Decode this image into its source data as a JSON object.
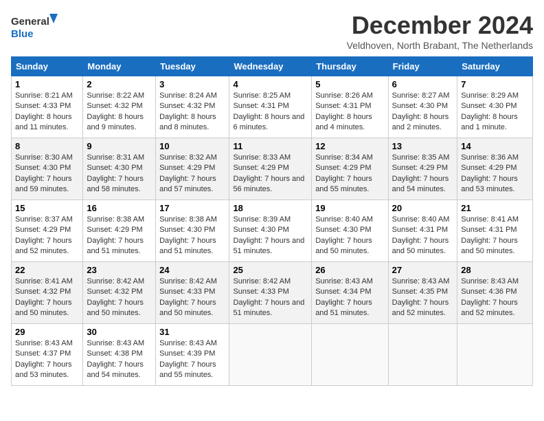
{
  "header": {
    "logo_general": "General",
    "logo_blue": "Blue",
    "month_title": "December 2024",
    "subtitle": "Veldhoven, North Brabant, The Netherlands"
  },
  "days_of_week": [
    "Sunday",
    "Monday",
    "Tuesday",
    "Wednesday",
    "Thursday",
    "Friday",
    "Saturday"
  ],
  "weeks": [
    [
      {
        "day": "1",
        "sunrise": "8:21 AM",
        "sunset": "4:33 PM",
        "daylight": "8 hours and 11 minutes."
      },
      {
        "day": "2",
        "sunrise": "8:22 AM",
        "sunset": "4:32 PM",
        "daylight": "8 hours and 9 minutes."
      },
      {
        "day": "3",
        "sunrise": "8:24 AM",
        "sunset": "4:32 PM",
        "daylight": "8 hours and 8 minutes."
      },
      {
        "day": "4",
        "sunrise": "8:25 AM",
        "sunset": "4:31 PM",
        "daylight": "8 hours and 6 minutes."
      },
      {
        "day": "5",
        "sunrise": "8:26 AM",
        "sunset": "4:31 PM",
        "daylight": "8 hours and 4 minutes."
      },
      {
        "day": "6",
        "sunrise": "8:27 AM",
        "sunset": "4:30 PM",
        "daylight": "8 hours and 2 minutes."
      },
      {
        "day": "7",
        "sunrise": "8:29 AM",
        "sunset": "4:30 PM",
        "daylight": "8 hours and 1 minute."
      }
    ],
    [
      {
        "day": "8",
        "sunrise": "8:30 AM",
        "sunset": "4:30 PM",
        "daylight": "7 hours and 59 minutes."
      },
      {
        "day": "9",
        "sunrise": "8:31 AM",
        "sunset": "4:30 PM",
        "daylight": "7 hours and 58 minutes."
      },
      {
        "day": "10",
        "sunrise": "8:32 AM",
        "sunset": "4:29 PM",
        "daylight": "7 hours and 57 minutes."
      },
      {
        "day": "11",
        "sunrise": "8:33 AM",
        "sunset": "4:29 PM",
        "daylight": "7 hours and 56 minutes."
      },
      {
        "day": "12",
        "sunrise": "8:34 AM",
        "sunset": "4:29 PM",
        "daylight": "7 hours and 55 minutes."
      },
      {
        "day": "13",
        "sunrise": "8:35 AM",
        "sunset": "4:29 PM",
        "daylight": "7 hours and 54 minutes."
      },
      {
        "day": "14",
        "sunrise": "8:36 AM",
        "sunset": "4:29 PM",
        "daylight": "7 hours and 53 minutes."
      }
    ],
    [
      {
        "day": "15",
        "sunrise": "8:37 AM",
        "sunset": "4:29 PM",
        "daylight": "7 hours and 52 minutes."
      },
      {
        "day": "16",
        "sunrise": "8:38 AM",
        "sunset": "4:29 PM",
        "daylight": "7 hours and 51 minutes."
      },
      {
        "day": "17",
        "sunrise": "8:38 AM",
        "sunset": "4:30 PM",
        "daylight": "7 hours and 51 minutes."
      },
      {
        "day": "18",
        "sunrise": "8:39 AM",
        "sunset": "4:30 PM",
        "daylight": "7 hours and 51 minutes."
      },
      {
        "day": "19",
        "sunrise": "8:40 AM",
        "sunset": "4:30 PM",
        "daylight": "7 hours and 50 minutes."
      },
      {
        "day": "20",
        "sunrise": "8:40 AM",
        "sunset": "4:31 PM",
        "daylight": "7 hours and 50 minutes."
      },
      {
        "day": "21",
        "sunrise": "8:41 AM",
        "sunset": "4:31 PM",
        "daylight": "7 hours and 50 minutes."
      }
    ],
    [
      {
        "day": "22",
        "sunrise": "8:41 AM",
        "sunset": "4:32 PM",
        "daylight": "7 hours and 50 minutes."
      },
      {
        "day": "23",
        "sunrise": "8:42 AM",
        "sunset": "4:32 PM",
        "daylight": "7 hours and 50 minutes."
      },
      {
        "day": "24",
        "sunrise": "8:42 AM",
        "sunset": "4:33 PM",
        "daylight": "7 hours and 50 minutes."
      },
      {
        "day": "25",
        "sunrise": "8:42 AM",
        "sunset": "4:33 PM",
        "daylight": "7 hours and 51 minutes."
      },
      {
        "day": "26",
        "sunrise": "8:43 AM",
        "sunset": "4:34 PM",
        "daylight": "7 hours and 51 minutes."
      },
      {
        "day": "27",
        "sunrise": "8:43 AM",
        "sunset": "4:35 PM",
        "daylight": "7 hours and 52 minutes."
      },
      {
        "day": "28",
        "sunrise": "8:43 AM",
        "sunset": "4:36 PM",
        "daylight": "7 hours and 52 minutes."
      }
    ],
    [
      {
        "day": "29",
        "sunrise": "8:43 AM",
        "sunset": "4:37 PM",
        "daylight": "7 hours and 53 minutes."
      },
      {
        "day": "30",
        "sunrise": "8:43 AM",
        "sunset": "4:38 PM",
        "daylight": "7 hours and 54 minutes."
      },
      {
        "day": "31",
        "sunrise": "8:43 AM",
        "sunset": "4:39 PM",
        "daylight": "7 hours and 55 minutes."
      },
      null,
      null,
      null,
      null
    ]
  ]
}
